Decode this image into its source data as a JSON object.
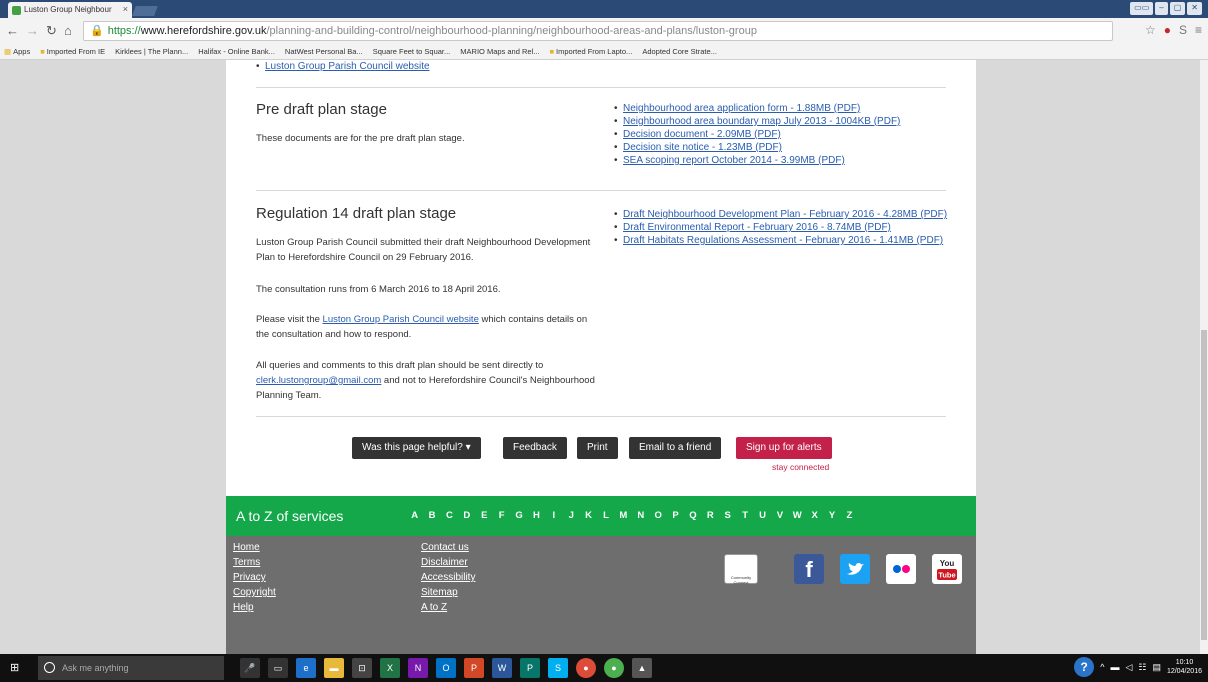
{
  "browser": {
    "tab_title": "Luston Group Neighbour",
    "tab_close": "×",
    "url_scheme": "https://",
    "url_host": "www.herefordshire.gov.uk",
    "url_path": "/planning-and-building-control/neighbourhood-planning/neighbourhood-areas-and-plans/luston-group",
    "bookmarks": [
      "Apps",
      "Imported From IE",
      "Kirklees | The Plann...",
      "Halifax - Online Bank...",
      "NatWest Personal Ba...",
      "Square Feet to Squar...",
      "MARIO Maps and Rel...",
      "Imported From Lapto...",
      "Adopted Core Strate..."
    ]
  },
  "page": {
    "top_link": "Luston Group Parish Council website",
    "pre_draft": {
      "title": "Pre draft plan stage",
      "text": "These documents are for the pre draft plan stage.",
      "links": [
        "Neighbourhood area application form - 1.88MB (PDF)",
        "Neighbourhood area boundary map July 2013 - 1004KB (PDF)",
        "Decision document - 2.09MB (PDF)",
        "Decision site notice - 1.23MB (PDF)",
        "SEA scoping report October 2014 - 3.99MB (PDF)"
      ]
    },
    "reg14": {
      "title": "Regulation 14 draft plan stage",
      "para1": "Luston Group Parish Council submitted their draft Neighbourhood Development Plan to Herefordshire Council on 29 February 2016.",
      "para2": "The consultation runs from 6 March 2016 to 18 April 2016.",
      "para3_pre": "Please visit the ",
      "para3_link": "Luston Group Parish Council website",
      "para3_post": " which contains details on the consultation and how to respond.",
      "para4_pre": "All queries and comments to this draft plan should be sent directly to ",
      "para4_link": "clerk.lustongroup@gmail.com",
      "para4_post": " and not to Herefordshire Council's Neighbourhood Planning Team.",
      "links": [
        "Draft Neighbourhood Development Plan - February 2016 - 4.28MB (PDF)",
        "Draft Environmental Report - February 2016 - 8.74MB (PDF)",
        "Draft Habitats Regulations Assessment - February 2016 - 1.41MB (PDF)"
      ]
    },
    "actions": {
      "helpful": "Was this page helpful?",
      "feedback": "Feedback",
      "print": "Print",
      "email": "Email to a friend",
      "alerts": "Sign up for alerts",
      "stay": "stay connected"
    },
    "az": {
      "title": "A to Z of services",
      "letters": [
        "A",
        "B",
        "C",
        "D",
        "E",
        "F",
        "G",
        "H",
        "I",
        "J",
        "K",
        "L",
        "M",
        "N",
        "O",
        "P",
        "Q",
        "R",
        "S",
        "T",
        "U",
        "V",
        "W",
        "X",
        "Y",
        "Z"
      ]
    },
    "footer": {
      "col1": [
        "Home",
        "Terms",
        "Privacy",
        "Copyright",
        "Help"
      ],
      "col2": [
        "Contact us",
        "Disclaimer",
        "Accessibility",
        "Sitemap",
        "A to Z"
      ],
      "social": {
        "community": "Community Connect",
        "facebook": "f",
        "youtube_top": "You",
        "youtube_bottom": "Tube"
      }
    }
  },
  "taskbar": {
    "search_placeholder": "Ask me anything",
    "time": "10:10",
    "date": "12/04/2016"
  },
  "colors": {
    "accent_green": "#14a84a",
    "alert_red": "#c3204a",
    "link_blue": "#2a5db0"
  }
}
